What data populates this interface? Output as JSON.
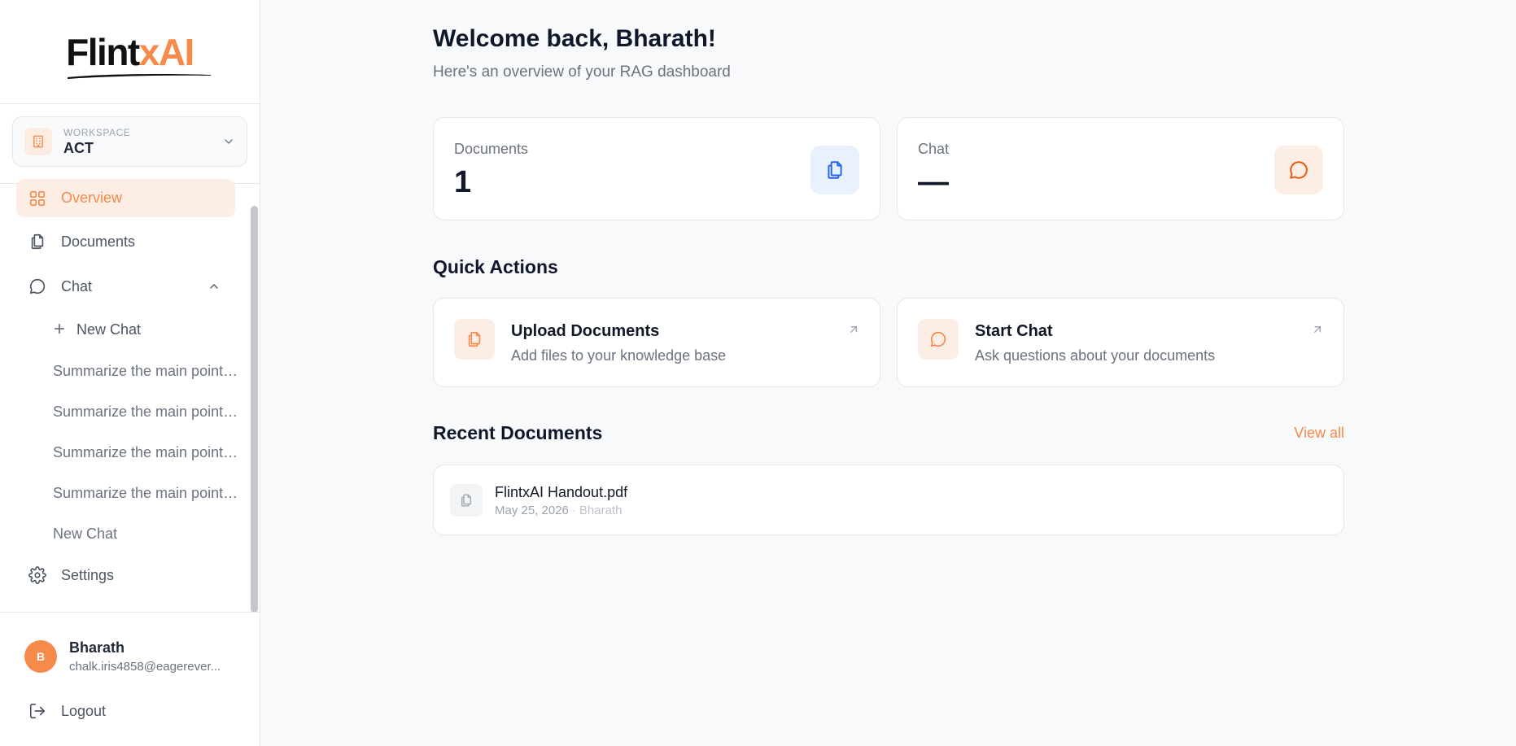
{
  "brand": {
    "logo_part1": "Flint",
    "logo_part2": "xAI",
    "accent_color": "#f58a4b"
  },
  "workspace": {
    "label": "WORKSPACE",
    "name": "ACT",
    "icon": "building-icon"
  },
  "sidebar": {
    "items": [
      {
        "label": "Overview",
        "icon": "grid-icon",
        "active": true
      },
      {
        "label": "Documents",
        "icon": "documents-icon"
      },
      {
        "label": "Chat",
        "icon": "chat-bubble-icon",
        "expanded": true
      }
    ],
    "new_chat_label": "New Chat",
    "chat_history": [
      "Summarize the main points of this document",
      "Summarize the main points of this document",
      "Summarize the main points of this document",
      "Summarize the main points of this document",
      "New Chat"
    ],
    "settings_label": "Settings",
    "logout_label": "Logout"
  },
  "user": {
    "initial": "B",
    "name": "Bharath",
    "email": "chalk.iris4858@eagerever..."
  },
  "main": {
    "welcome": "Welcome back, Bharath!",
    "subtitle": "Here's an overview of your RAG dashboard",
    "stats": [
      {
        "label": "Documents",
        "value": "1",
        "icon": "documents-icon",
        "color": "#2563eb"
      },
      {
        "label": "Chat",
        "value": "—",
        "icon": "chat-bubble-icon",
        "color": "#ea580c"
      }
    ],
    "quick_actions_title": "Quick Actions",
    "quick_actions": [
      {
        "title": "Upload Documents",
        "description": "Add files to your knowledge base",
        "icon": "documents-icon"
      },
      {
        "title": "Start Chat",
        "description": "Ask questions about your documents",
        "icon": "chat-bubble-icon"
      }
    ],
    "recent_title": "Recent Documents",
    "view_all_label": "View all",
    "recent_documents": [
      {
        "name": "FlintxAI Handout.pdf",
        "date": "May 25, 2026",
        "author": "Bharath"
      }
    ]
  }
}
